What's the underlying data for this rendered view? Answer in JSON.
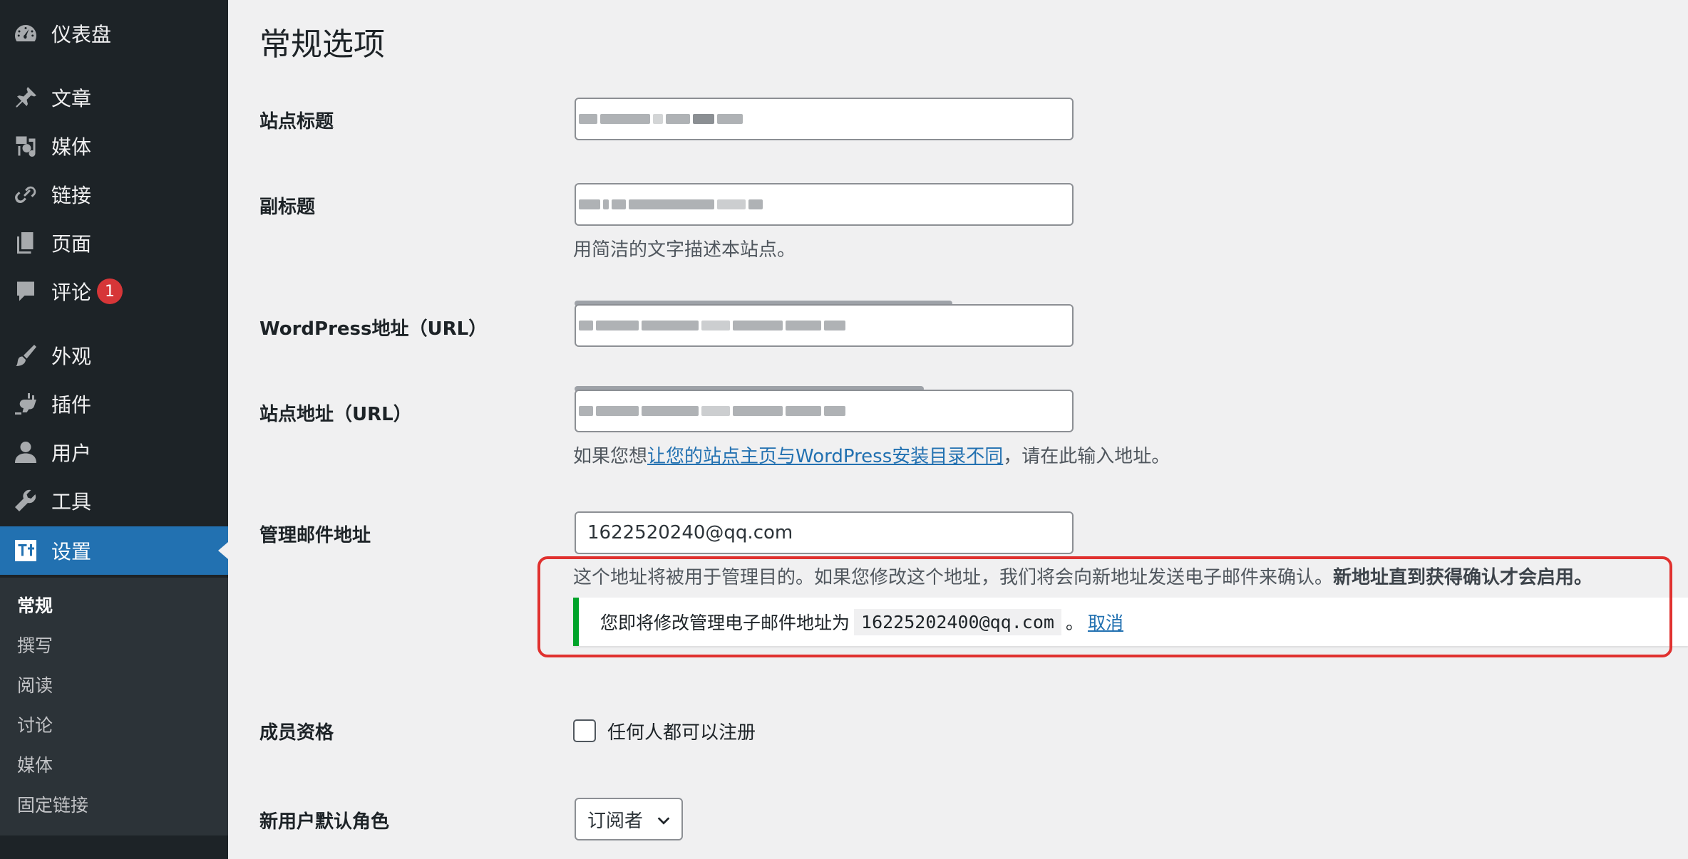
{
  "sidebar": {
    "items": [
      {
        "label": "仪表盘",
        "icon": "dashboard-icon"
      },
      {
        "label": "文章",
        "icon": "pin-icon"
      },
      {
        "label": "媒体",
        "icon": "media-icon"
      },
      {
        "label": "链接",
        "icon": "link-icon"
      },
      {
        "label": "页面",
        "icon": "pages-icon"
      },
      {
        "label": "评论",
        "icon": "comment-icon",
        "badge": "1"
      },
      {
        "label": "外观",
        "icon": "brush-icon"
      },
      {
        "label": "插件",
        "icon": "plugin-icon"
      },
      {
        "label": "用户",
        "icon": "user-icon"
      },
      {
        "label": "工具",
        "icon": "wrench-icon"
      },
      {
        "label": "设置",
        "icon": "settings-icon",
        "active": true
      }
    ],
    "submenu": [
      "常规",
      "撰写",
      "阅读",
      "讨论",
      "媒体",
      "固定链接"
    ],
    "submenu_current": "常规"
  },
  "page": {
    "title": "常规选项"
  },
  "form": {
    "site_title": {
      "label": "站点标题"
    },
    "tagline": {
      "label": "副标题",
      "description": "用简洁的文字描述本站点。"
    },
    "wp_url": {
      "label": "WordPress地址（URL）"
    },
    "site_url": {
      "label": "站点地址（URL）",
      "desc_prefix": "如果您想",
      "desc_link": "让您的站点主页与WordPress安装目录不同",
      "desc_suffix": "，请在此输入地址。"
    },
    "admin_email": {
      "label": "管理邮件地址",
      "value": "1622520240@qq.com",
      "desc_normal": "这个地址将被用于管理目的。如果您修改这个地址，我们将会向新地址发送电子邮件来确认。",
      "desc_bold": "新地址直到获得确认才会启用。"
    },
    "notice": {
      "prefix": "您即将修改管理电子邮件地址为",
      "new_email": "16225202400@qq.com",
      "suffix": "。",
      "cancel": "取消"
    },
    "membership": {
      "label": "成员资格",
      "checkbox_label": "任何人都可以注册",
      "checked": false
    },
    "default_role": {
      "label": "新用户默认角色",
      "selected": "订阅者"
    }
  },
  "colors": {
    "sidebar_bg": "#1d2327",
    "accent": "#2271b1",
    "notice_success": "#00a32a",
    "badge": "#d63638",
    "annotation": "#e0312f"
  }
}
